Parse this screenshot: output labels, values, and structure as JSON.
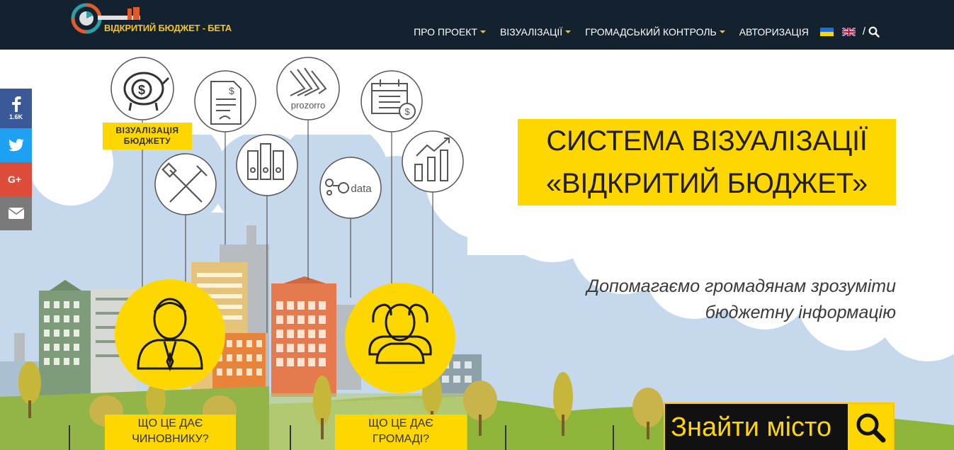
{
  "header": {
    "logo_text": "ВІДКРИТИЙ БЮДЖЕТ - БЕТА",
    "nav": [
      {
        "label": "ПРО ПРОЕКТ",
        "dropdown": true
      },
      {
        "label": "ВІЗУАЛІЗАЦІЇ",
        "dropdown": true
      },
      {
        "label": "ГРОМАДСЬКИЙ КОНТРОЛЬ",
        "dropdown": true
      },
      {
        "label": "АВТОРИЗАЦІЯ",
        "dropdown": false
      }
    ],
    "slash": "/"
  },
  "social": {
    "facebook_count": "1.6K",
    "icons": [
      "facebook-icon",
      "twitter-icon",
      "google-plus-icon",
      "email-icon"
    ]
  },
  "hero": {
    "title_line1": "СИСТЕМА ВІЗУАЛІЗАЦІЇ",
    "title_line2": "«ВІДКРИТИЙ БЮДЖЕТ»",
    "tagline_line1": "Допомагаємо громадянам зрозуміти",
    "tagline_line2": "бюджетну інформацію",
    "viz_label_line1": "ВІЗУАЛІЗАЦІЯ",
    "viz_label_line2": "БЮДЖЕТУ",
    "prozorro_text": "prozorro",
    "edata_text": "data",
    "card_official_line1": "ЩО ЦЕ ДАЄ",
    "card_official_line2": "ЧИНОВНИКУ?",
    "card_community_line1": "ЩО ЦЕ ДАЄ",
    "card_community_line2": "ГРОМАДІ?",
    "find_city": "Знайти місто"
  },
  "colors": {
    "header_bg": "#13222e",
    "accent_yellow": "#ffd700",
    "logo_yellow": "#f5c518",
    "sky_blue": "#bcd4ea",
    "grass_green": "#8fb43a"
  }
}
